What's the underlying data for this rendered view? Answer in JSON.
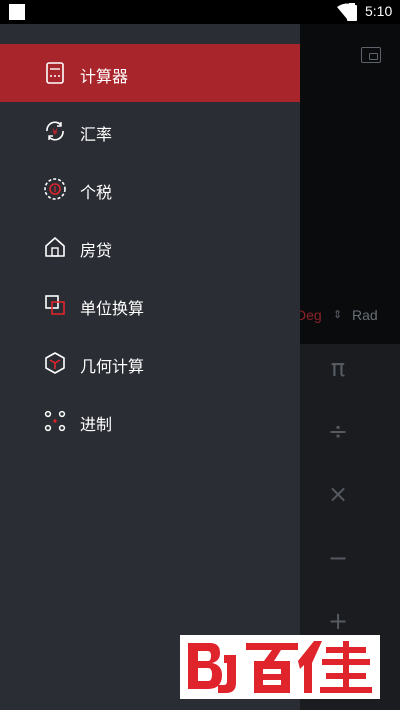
{
  "status_bar": {
    "time": "5:10",
    "icons": [
      "notification-square-icon",
      "wifi-icon",
      "battery-icon"
    ]
  },
  "background_calculator": {
    "angle_modes": {
      "deg": "Deg",
      "separator": "⇕",
      "rad": "Rad"
    },
    "operators": [
      "π",
      "÷",
      "×",
      "−",
      "+"
    ],
    "icons": [
      "compact-mode-icon"
    ]
  },
  "drawer": {
    "items": [
      {
        "label": "计算器",
        "icon": "calculator-icon",
        "active": true
      },
      {
        "label": "汇率",
        "icon": "exchange-rate-icon",
        "active": false
      },
      {
        "label": "个税",
        "icon": "tax-icon",
        "active": false
      },
      {
        "label": "房贷",
        "icon": "house-icon",
        "active": false
      },
      {
        "label": "单位换算",
        "icon": "unit-conversion-icon",
        "active": false
      },
      {
        "label": "几何计算",
        "icon": "geometry-icon",
        "active": false
      },
      {
        "label": "进制",
        "icon": "number-base-icon",
        "active": false
      }
    ]
  },
  "watermark": {
    "text": "百佳",
    "colors": {
      "brand": "#e0242b",
      "drawer_bg": "#2a2d33",
      "active_bg": "#a8252b"
    }
  }
}
